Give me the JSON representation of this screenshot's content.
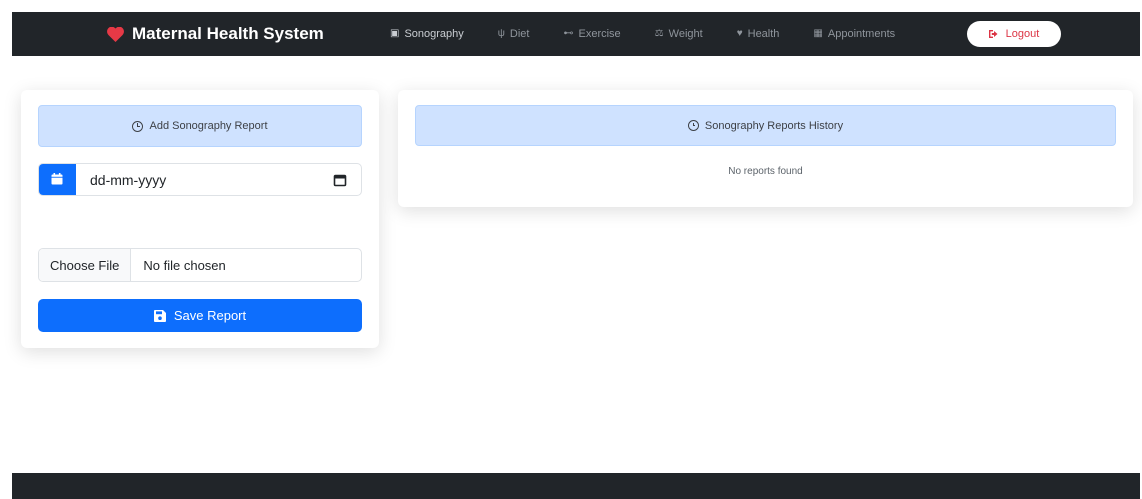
{
  "navbar": {
    "brand": "Maternal Health System",
    "links": [
      {
        "label": "Sonography",
        "icon": "image-icon"
      },
      {
        "label": "Diet",
        "icon": "utensils-icon"
      },
      {
        "label": "Exercise",
        "icon": "dumbbell-icon"
      },
      {
        "label": "Weight",
        "icon": "scale-icon"
      },
      {
        "label": "Health",
        "icon": "heartbeat-icon"
      },
      {
        "label": "Appointments",
        "icon": "calendar-icon"
      }
    ],
    "logout": "Logout"
  },
  "add_form": {
    "title": "Add Sonography Report",
    "date_placeholder": "dd-mm-yyyy",
    "file_button": "Choose File",
    "file_status": "No file chosen",
    "save_label": "Save Report"
  },
  "history": {
    "title": "Sonography Reports History",
    "empty_message": "No reports found"
  },
  "colors": {
    "navbar": "#212529",
    "primary": "#0d6efd",
    "header_bg": "#cfe2ff",
    "heart": "#e63946",
    "logout_text": "#dc3545"
  }
}
